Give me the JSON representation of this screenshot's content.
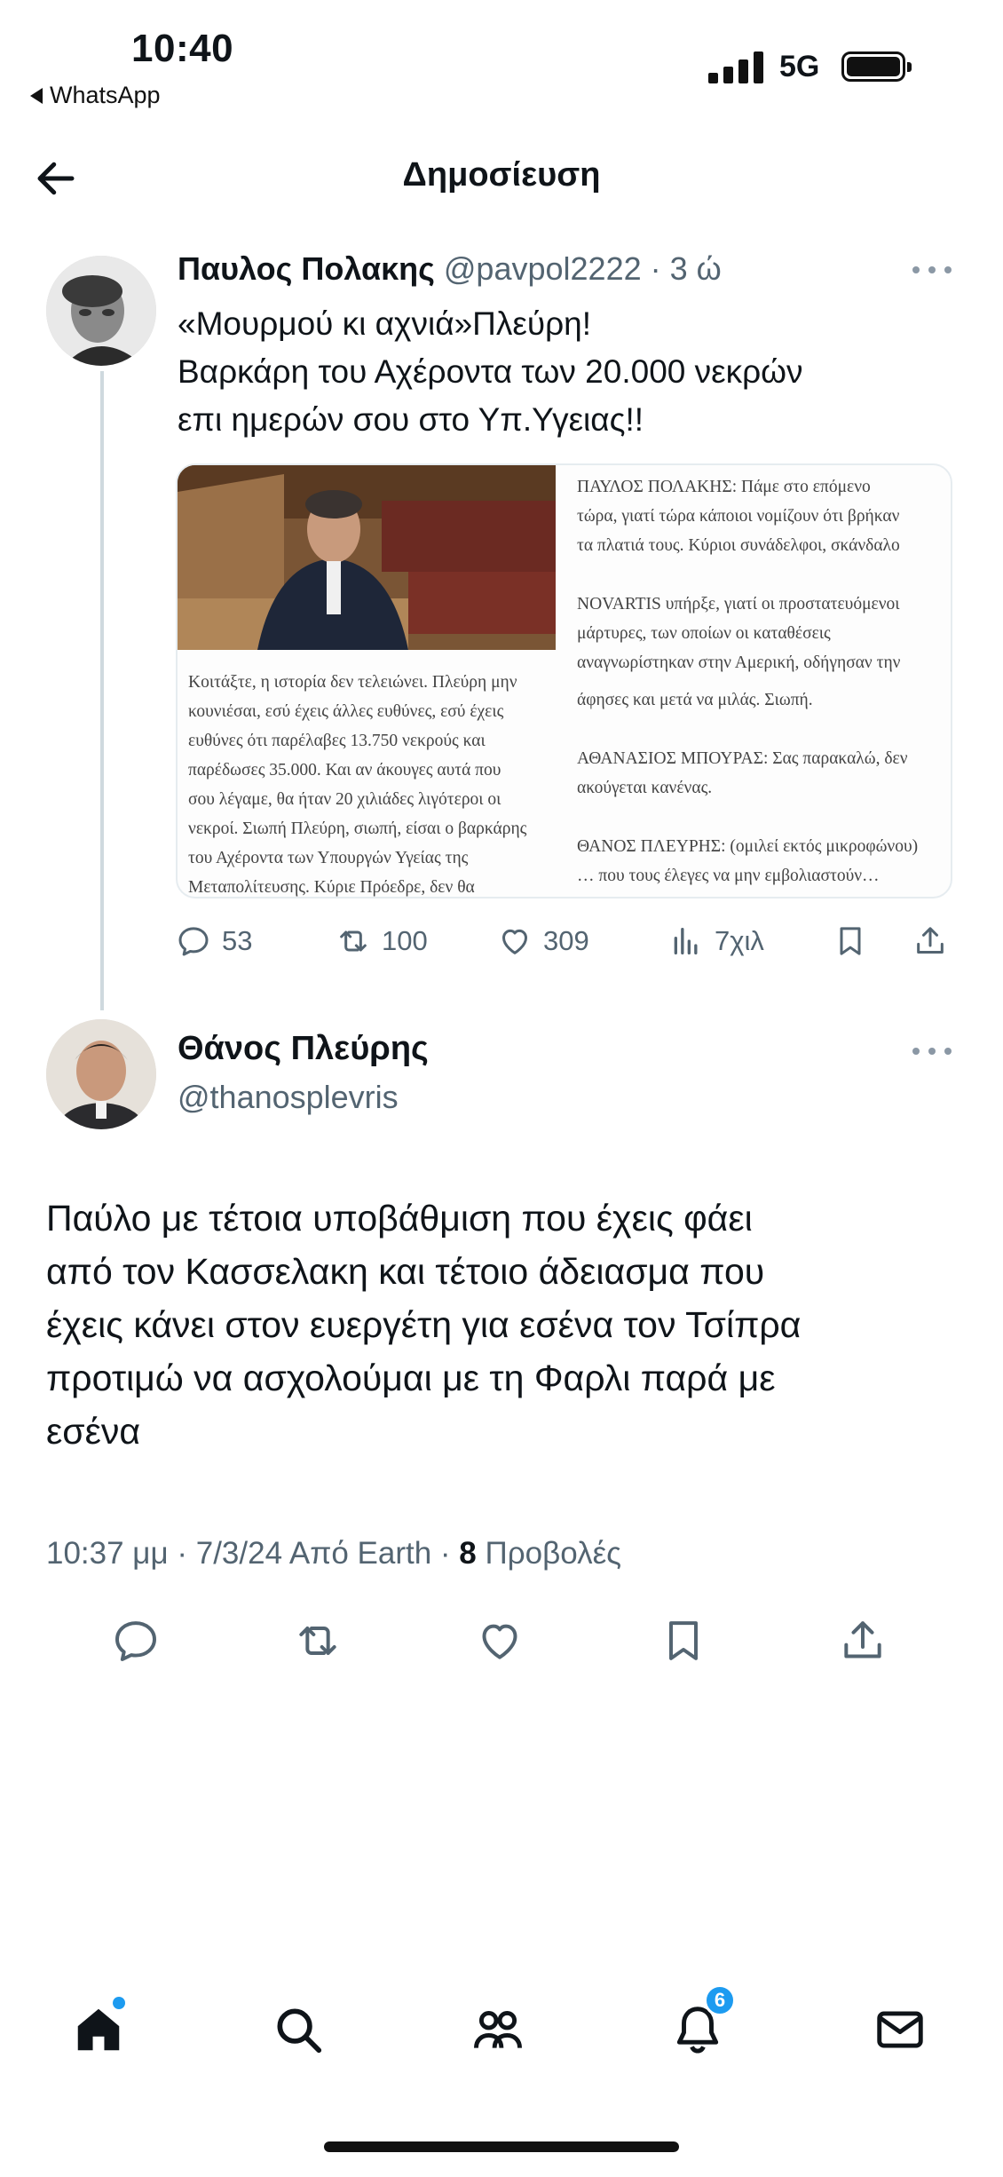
{
  "status_bar": {
    "time": "10:40",
    "back_app": "WhatsApp",
    "network": "5G"
  },
  "header": {
    "title": "Δημοσίευση",
    "back_icon": "arrow-left-icon"
  },
  "tweet_1": {
    "author_name": "Παυλος Πολακης",
    "handle_and_time": "@pavpol2222 · 3 ώ",
    "text_lines": [
      "«Μουρμού κι αχνιά»Πλεύρη!",
      "Βαρκάρη του Αχέροντα των 20.000 νεκρών",
      "επι ημερών σου στο Υπ.Υγειας!!"
    ],
    "media": {
      "right_top_lines": [
        "ΠΑΥΛΟΣ ΠΟΛΑΚΗΣ: Πάμε στο επόμενο",
        "τώρα, γιατί τώρα κάποιοι νομίζουν ότι βρήκαν",
        "τα πλατιά τους. Κύριοι συνάδελφοι, σκάνδαλο",
        "",
        "NOVARTIS υπήρξε, γιατί οι προστατευόμενοι",
        "μάρτυρες, των οποίων οι καταθέσεις",
        "αναγνωρίστηκαν στην Αμερική, οδήγησαν την"
      ],
      "left_bottom_lines": [
        "Κοιτάξτε, η ιστορία δεν τελειώνει. Πλεύρη μην",
        "κουνιέσαι, εσύ έχεις άλλες ευθύνες, εσύ έχεις",
        "ευθύνες ότι παρέλαβες 13.750 νεκρούς και",
        "παρέδωσες 35.000. Και αν άκουγες αυτά που",
        "σου λέγαμε, θα ήταν 20 χιλιάδες λιγότεροι οι",
        "νεκροί. Σιωπή Πλεύρη, σιωπή, είσαι ο βαρκάρης",
        "του Αχέροντα των Υπουργών Υγείας της",
        "Μεταπολίτευσης. Κύριε Πρόεδρε, δεν θα"
      ],
      "right_bottom_lines": [
        "άφησες και μετά να μιλάς. Σιωπή.",
        "",
        "ΑΘΑΝΑΣΙΟΣ ΜΠΟΥΡΑΣ: Σας παρακαλώ, δεν",
        "ακούγεται κανένας.",
        "",
        "ΘΑΝΟΣ ΠΛΕΥΡΗΣ: (ομιλεί εκτός μικροφώνου)",
        "… που τους έλεγες να μην εμβολιαστούν…"
      ]
    },
    "stats": {
      "replies": "53",
      "retweets": "100",
      "likes": "309",
      "views": "7χιλ"
    }
  },
  "tweet_2": {
    "author_name": "Θάνος Πλεύρης",
    "handle": "@thanosplevris",
    "text_lines": [
      "Παύλο με τέτοια υποβάθμιση που έχεις φάει",
      "από τον Κασσελακη και τέτοιο άδειασμα που",
      "έχεις κάνει στον ευεργέτη για εσένα τον Τσίπρα",
      "προτιμώ να ασχολούμαι με τη Φαρλι παρά με",
      "εσένα"
    ],
    "meta": {
      "time_date_source": "10:37 μμ · 7/3/24 Από Earth · ",
      "views_count": "8",
      "views_label": " Προβολές"
    }
  },
  "bottom_nav": {
    "notification_count": "6",
    "items": [
      "home-icon",
      "search-icon",
      "communities-icon",
      "notifications-icon",
      "messages-icon"
    ]
  }
}
